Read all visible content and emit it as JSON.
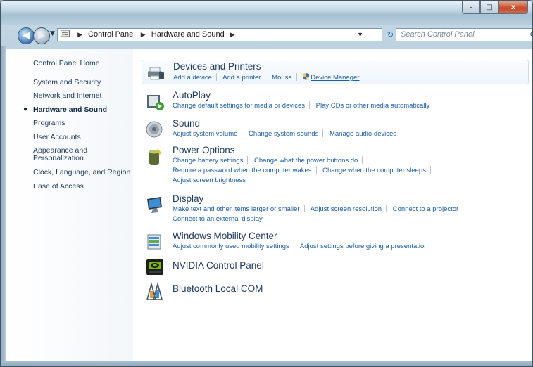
{
  "window": {
    "caption_buttons": {
      "minimize": "–",
      "maximize": "□",
      "close": "x"
    }
  },
  "address_bar": {
    "breadcrumbs": [
      "Control Panel",
      "Hardware and Sound"
    ],
    "search_placeholder": "Search Control Panel"
  },
  "sidebar": {
    "items": [
      {
        "label": "Control Panel Home"
      },
      {
        "label": "System and Security"
      },
      {
        "label": "Network and Internet"
      },
      {
        "label": "Hardware and Sound",
        "current": true
      },
      {
        "label": "Programs"
      },
      {
        "label": "User Accounts"
      },
      {
        "label": "Appearance and\nPersonalization"
      },
      {
        "label": "Clock, Language, and Region"
      },
      {
        "label": "Ease of Access"
      }
    ]
  },
  "categories": [
    {
      "title": "Devices and Printers",
      "icon": "printer-icon",
      "links": [
        [
          "Add a device",
          "Add a printer",
          "Mouse",
          "Device Manager"
        ]
      ]
    },
    {
      "title": "AutoPlay",
      "icon": "autoplay-icon",
      "links": [
        [
          "Change default settings for media or devices",
          "Play CDs or other media automatically"
        ]
      ]
    },
    {
      "title": "Sound",
      "icon": "speaker-icon",
      "links": [
        [
          "Adjust system volume",
          "Change system sounds",
          "Manage audio devices"
        ]
      ]
    },
    {
      "title": "Power Options",
      "icon": "battery-icon",
      "links": [
        [
          "Change battery settings",
          "Change what the power buttons do"
        ],
        [
          "Require a password when the computer wakes",
          "Change when the computer sleeps"
        ],
        [
          "Adjust screen brightness"
        ]
      ]
    },
    {
      "title": "Display",
      "icon": "monitor-icon",
      "links": [
        [
          "Make text and other items larger or smaller",
          "Adjust screen resolution",
          "Connect to a projector"
        ],
        [
          "Connect to an external display"
        ]
      ]
    },
    {
      "title": "Windows Mobility Center",
      "icon": "mobility-center-icon",
      "links": [
        [
          "Adjust commonly used mobility settings",
          "Adjust settings before giving a presentation"
        ]
      ]
    },
    {
      "title": "NVIDIA Control Panel",
      "icon": "nvidia-icon",
      "links": []
    },
    {
      "title": "Bluetooth Local COM",
      "icon": "bluetooth-icon",
      "links": []
    }
  ]
}
